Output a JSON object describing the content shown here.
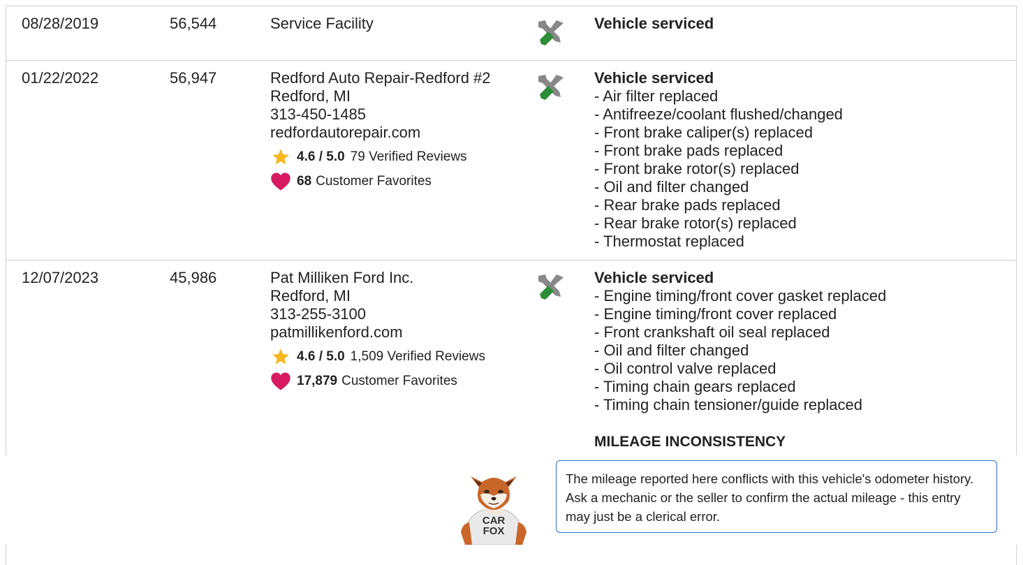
{
  "rows": [
    {
      "date": "08/28/2019",
      "odometer": "56,544",
      "source_lines": [
        "Service Facility"
      ],
      "icon": "wrench-screwdriver-icon",
      "title": "Vehicle serviced",
      "items": []
    },
    {
      "date": "01/22/2022",
      "odometer": "56,947",
      "source_lines": [
        "Redford Auto Repair-Redford #2",
        "Redford, MI",
        "313-450-1485",
        "redfordautorepair.com"
      ],
      "rating": "4.6 / 5.0",
      "reviews": "79 Verified Reviews",
      "favorites_count": "68",
      "favorites_label": "Customer Favorites",
      "icon": "wrench-screwdriver-icon",
      "title": "Vehicle serviced",
      "items": [
        "- Air filter replaced",
        "- Antifreeze/coolant flushed/changed",
        "- Front brake caliper(s) replaced",
        "- Front brake pads replaced",
        "- Front brake rotor(s) replaced",
        "- Oil and filter changed",
        "- Rear brake pads replaced",
        "- Rear brake rotor(s) replaced",
        "- Thermostat replaced"
      ]
    },
    {
      "date": "12/07/2023",
      "odometer": "45,986",
      "source_lines": [
        "Pat Milliken Ford Inc.",
        "Redford, MI",
        "313-255-3100",
        "patmillikenford.com"
      ],
      "rating": "4.6 / 5.0",
      "reviews": "1,509 Verified Reviews",
      "favorites_count": "17,879",
      "favorites_label": "Customer Favorites",
      "icon": "wrench-screwdriver-icon",
      "title": "Vehicle serviced",
      "items": [
        "- Engine timing/front cover gasket replaced",
        "- Engine timing/front cover replaced",
        "- Front crankshaft oil seal replaced",
        "- Oil and filter changed",
        "- Oil control valve replaced",
        "- Timing chain gears replaced",
        "- Timing chain tensioner/guide replaced"
      ],
      "alert_title": "MILEAGE INCONSISTENCY"
    }
  ],
  "callout": {
    "text": "The mileage reported here conflicts with this vehicle's odometer history. Ask a mechanic or the seller to confirm the actual mileage - this entry may just be a clerical error."
  },
  "mascot": {
    "shirt_line1": "CAR",
    "shirt_line2": "FOX",
    "icon": "carfox-mascot-icon"
  },
  "colors": {
    "star": "#f5b820",
    "heart": "#d81b60",
    "callout_border": "#2a6cc4",
    "screwdriver": "#2e8b3a",
    "wrench": "#888888"
  }
}
